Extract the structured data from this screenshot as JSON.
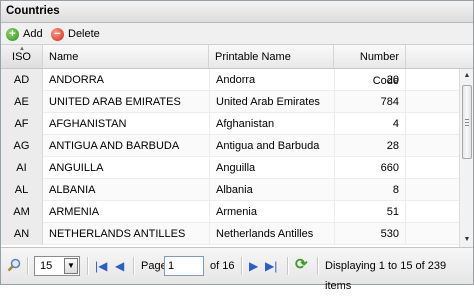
{
  "panel": {
    "title": "Countries"
  },
  "toolbar": {
    "add_label": "Add",
    "delete_label": "Delete"
  },
  "columns": {
    "iso": "ISO",
    "name": "Name",
    "printable": "Printable Name",
    "number": "Number Code"
  },
  "rows": [
    {
      "iso": "AD",
      "name": "ANDORRA",
      "printable": "Andorra",
      "number": "20"
    },
    {
      "iso": "AE",
      "name": "UNITED ARAB EMIRATES",
      "printable": "United Arab Emirates",
      "number": "784"
    },
    {
      "iso": "AF",
      "name": "AFGHANISTAN",
      "printable": "Afghanistan",
      "number": "4"
    },
    {
      "iso": "AG",
      "name": "ANTIGUA AND BARBUDA",
      "printable": "Antigua and Barbuda",
      "number": "28"
    },
    {
      "iso": "AI",
      "name": "ANGUILLA",
      "printable": "Anguilla",
      "number": "660"
    },
    {
      "iso": "AL",
      "name": "ALBANIA",
      "printable": "Albania",
      "number": "8"
    },
    {
      "iso": "AM",
      "name": "ARMENIA",
      "printable": "Armenia",
      "number": "51"
    },
    {
      "iso": "AN",
      "name": "NETHERLANDS ANTILLES",
      "printable": "Netherlands Antilles",
      "number": "530"
    }
  ],
  "pager": {
    "page_size": "15",
    "page_label": "Page",
    "page_value": "1",
    "of_label": "of 16",
    "display_text": "Displaying 1 to 15 of 239 items"
  },
  "icons": {
    "add": "add-icon",
    "delete": "delete-icon",
    "search": "search-icon",
    "first": "first-page-icon",
    "prev": "prev-page-icon",
    "next": "next-page-icon",
    "last": "last-page-icon",
    "refresh": "refresh-icon"
  }
}
